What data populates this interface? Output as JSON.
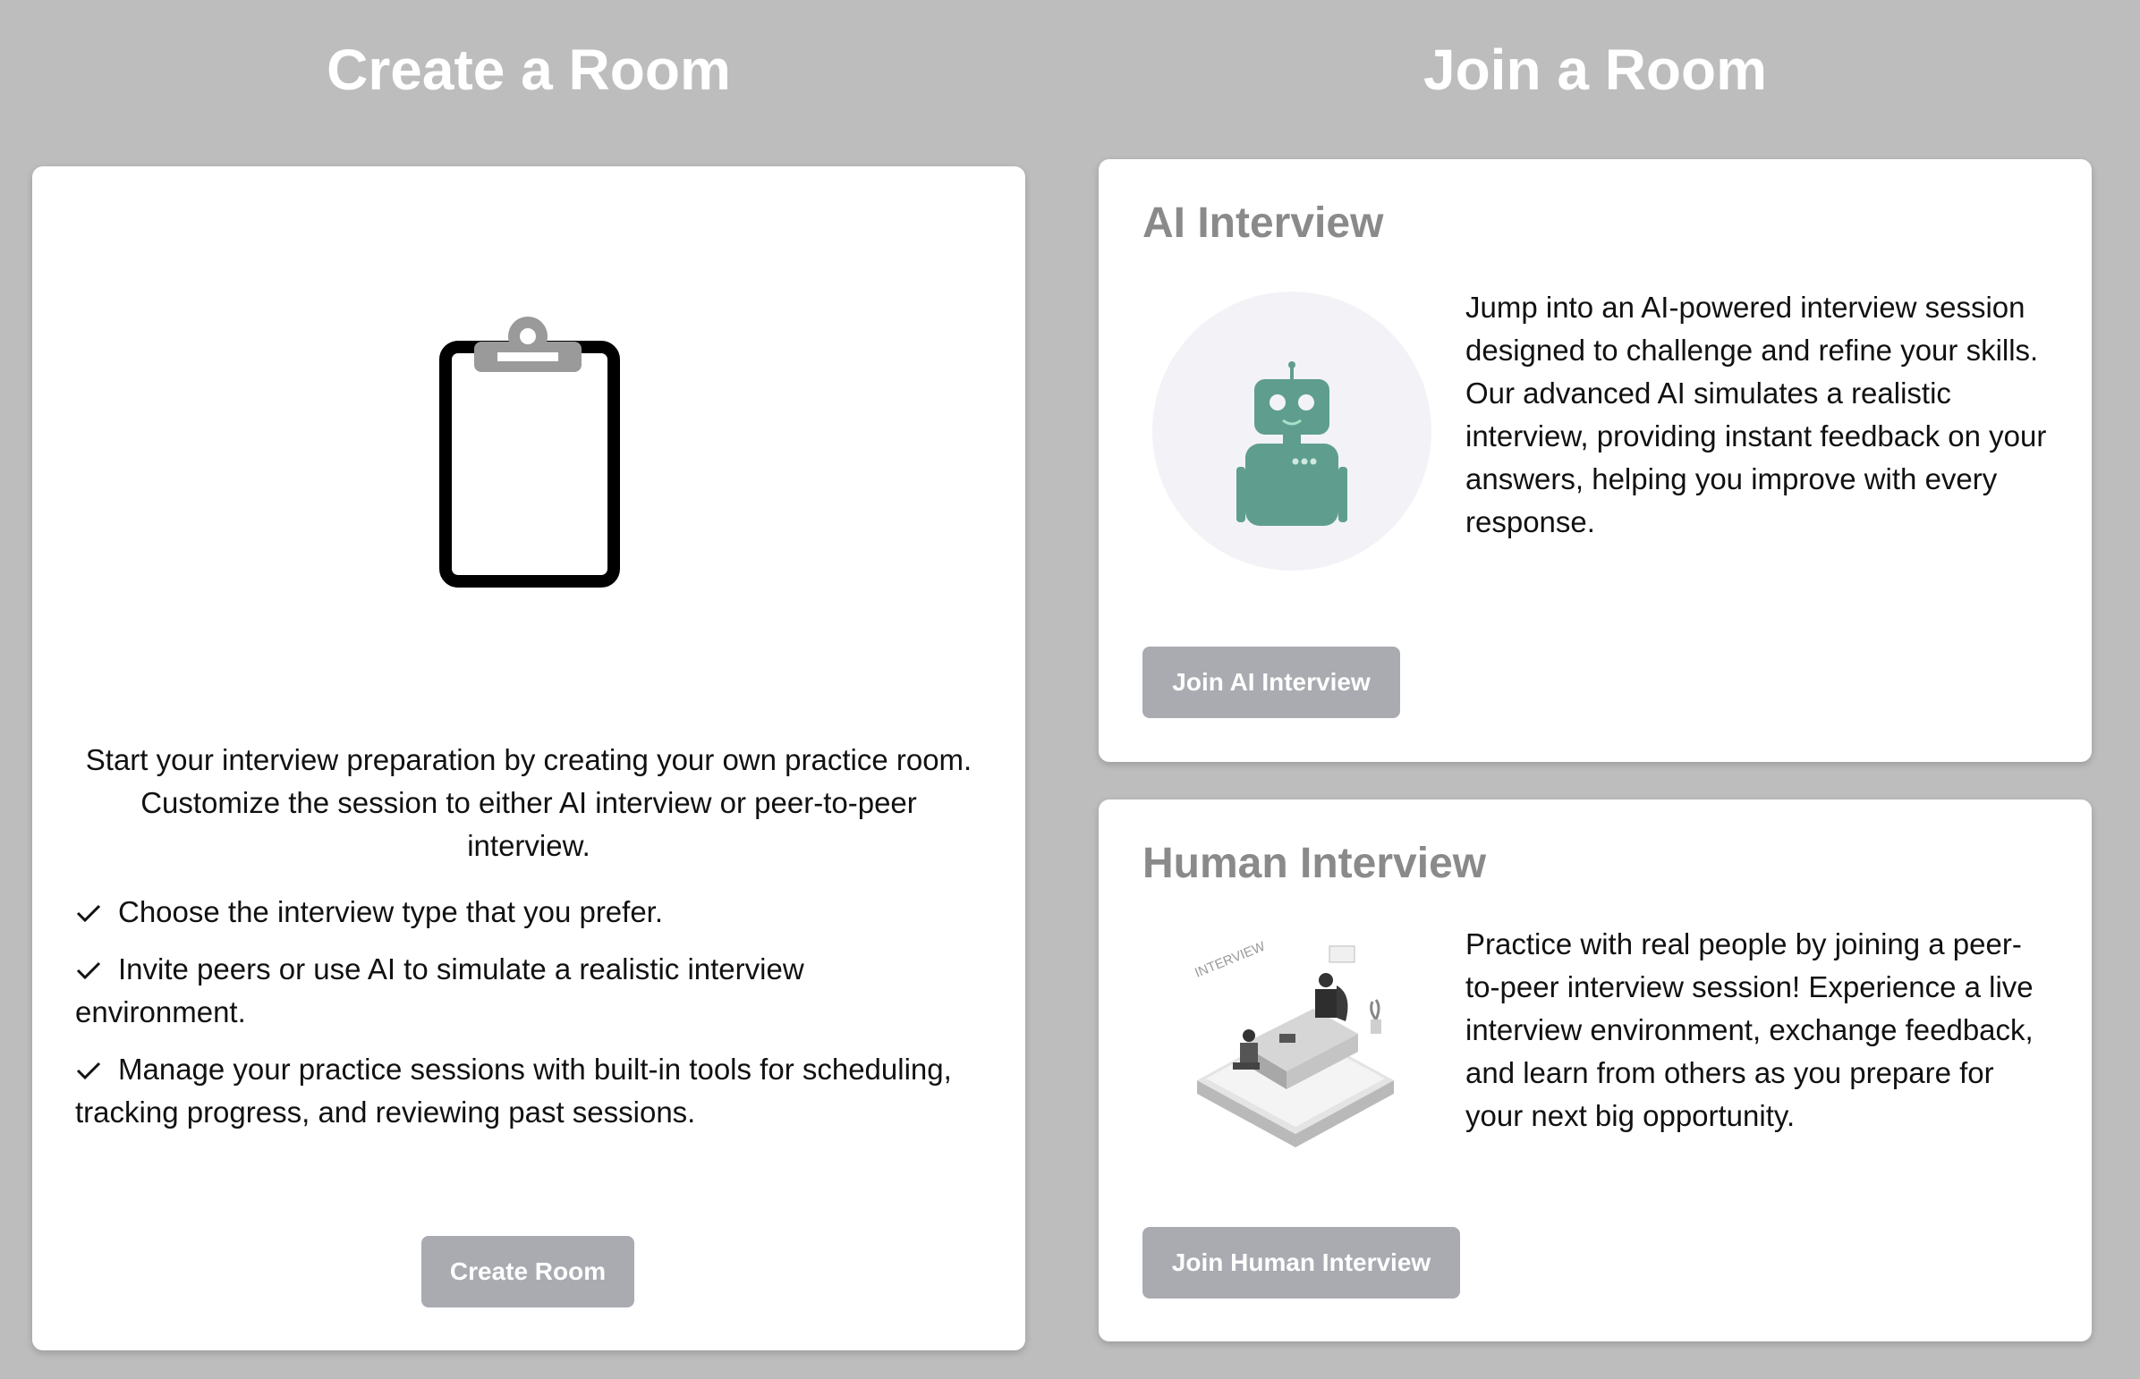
{
  "create_section": {
    "title": "Create a Room",
    "description": "Start your interview preparation by creating your own practice room. Customize the session to either AI interview or peer-to-peer interview.",
    "features": [
      "Choose the interview type that you prefer.",
      "Invite peers or use AI to simulate a realistic interview environment.",
      "Manage your practice sessions with built-in tools for scheduling, tracking progress, and reviewing past sessions."
    ],
    "button_label": "Create Room"
  },
  "join_section": {
    "title": "Join a Room",
    "ai_card": {
      "heading": "AI Interview",
      "description": "Jump into an AI-powered interview session designed to challenge and refine your skills. Our advanced AI simulates a realistic interview, providing instant feedback on your answers, helping you improve with every response.",
      "button_label": "Join AI Interview"
    },
    "human_card": {
      "heading": "Human Interview",
      "description": "Practice with real people by joining a peer-to-peer interview session! Experience a live interview environment, exchange feedback, and learn from others as you prepare for your next big opportunity.",
      "illustration_text": "INTERVIEW",
      "button_label": "Join Human Interview"
    }
  },
  "icons": {
    "clipboard": "clipboard-icon",
    "check": "check-icon",
    "robot": "robot-illustration",
    "interview": "interview-illustration"
  },
  "colors": {
    "background": "#bdbdbd",
    "card": "#ffffff",
    "button": "#a9abb1",
    "heading_gray": "#8a8a8a",
    "robot": "#5f9e8f",
    "robot_circle": "#f3f3f7"
  }
}
